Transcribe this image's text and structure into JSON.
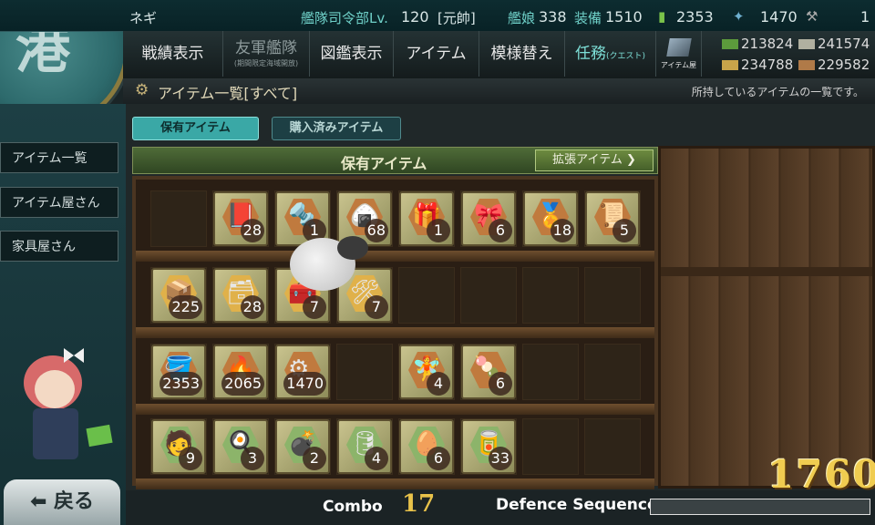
{
  "top": {
    "player_name": "ネギ",
    "hq_label": "艦隊司令部Lv.",
    "hq_level": "120",
    "rank": "[元帥]",
    "ships_label": "艦娘",
    "ships_count": "338",
    "equip_label": "装備",
    "equip_count": "1510",
    "bucket_count": "2353",
    "devmat_count": "1470",
    "screw_count": "1"
  },
  "nav": {
    "items": [
      {
        "label": "戦績表示"
      },
      {
        "label": "友軍艦隊",
        "sub": "(期間限定海域開放)"
      },
      {
        "label": "図鑑表示"
      },
      {
        "label": "アイテム"
      },
      {
        "label": "模様替え"
      },
      {
        "label": "任務",
        "sub_inline": "(クエスト)"
      },
      {
        "label": "アイテム屋"
      }
    ]
  },
  "resources": {
    "fuel": "213824",
    "ammo": "241574",
    "steel": "234788",
    "bauxite": "229582"
  },
  "title": {
    "heading": "アイテム一覧[すべて]",
    "description": "所持しているアイテムの一覧です。"
  },
  "sidebar": {
    "items": [
      {
        "label": "アイテム一覧"
      },
      {
        "label": "アイテム屋さん"
      },
      {
        "label": "家具屋さん"
      }
    ],
    "back_label": "戻る"
  },
  "tabs": {
    "owned": "保有アイテム",
    "purchased": "購入済みアイテム"
  },
  "shelf": {
    "header": "保有アイテム",
    "expand": "拡張アイテム"
  },
  "rows": [
    [
      null,
      {
        "icon": "mailbox-icon",
        "glyph": "📕",
        "count": "28"
      },
      {
        "icon": "screw-icon",
        "glyph": "🔩",
        "count": "1"
      },
      {
        "icon": "rice-ball-icon",
        "glyph": "🍙",
        "count": "68"
      },
      {
        "icon": "gift-box-icon",
        "glyph": "🎁",
        "count": "1"
      },
      {
        "icon": "ribbon-icon",
        "glyph": "🎀",
        "count": "6"
      },
      {
        "icon": "medal-icon",
        "glyph": "🏅",
        "count": "18"
      },
      {
        "icon": "chart-icon",
        "glyph": "📜",
        "count": "5"
      }
    ],
    [
      {
        "icon": "furniture-box-small-icon",
        "glyph": "📦",
        "count": "225"
      },
      {
        "icon": "furniture-box-medium-icon",
        "glyph": "🗃",
        "count": "28"
      },
      {
        "icon": "furniture-box-large-icon",
        "glyph": "🧰",
        "count": "7"
      },
      {
        "icon": "craftsman-icon",
        "glyph": "🛠",
        "count": "7"
      },
      null,
      null,
      null,
      null
    ],
    [
      {
        "icon": "bucket-icon",
        "glyph": "🪣",
        "count": "2353"
      },
      {
        "icon": "flamethrower-icon",
        "glyph": "🔥",
        "count": "2065"
      },
      {
        "icon": "devmat-icon",
        "glyph": "⚙",
        "count": "1470"
      },
      null,
      {
        "icon": "fairy-icon",
        "glyph": "🧚",
        "count": "4"
      },
      {
        "icon": "mamiya-icon",
        "glyph": "🍡",
        "count": "6"
      },
      null,
      null
    ],
    [
      {
        "icon": "fairy-pilot-icon",
        "glyph": "🧑",
        "count": "9"
      },
      {
        "icon": "fairy-cook-icon",
        "glyph": "🍳",
        "count": "3"
      },
      {
        "icon": "ammo-box-icon",
        "glyph": "💣",
        "count": "2"
      },
      {
        "icon": "drum-icon",
        "glyph": "🛢",
        "count": "4"
      },
      {
        "icon": "boiled-egg-icon",
        "glyph": "🥚",
        "count": "6"
      },
      {
        "icon": "canned-food-icon",
        "glyph": "🥫",
        "count": "33"
      },
      null,
      null
    ]
  ],
  "hud": {
    "score": "1760",
    "combo_label": "Combo",
    "combo_value": "17",
    "defence_label": "Defence Sequence",
    "defence_progress": 0
  }
}
